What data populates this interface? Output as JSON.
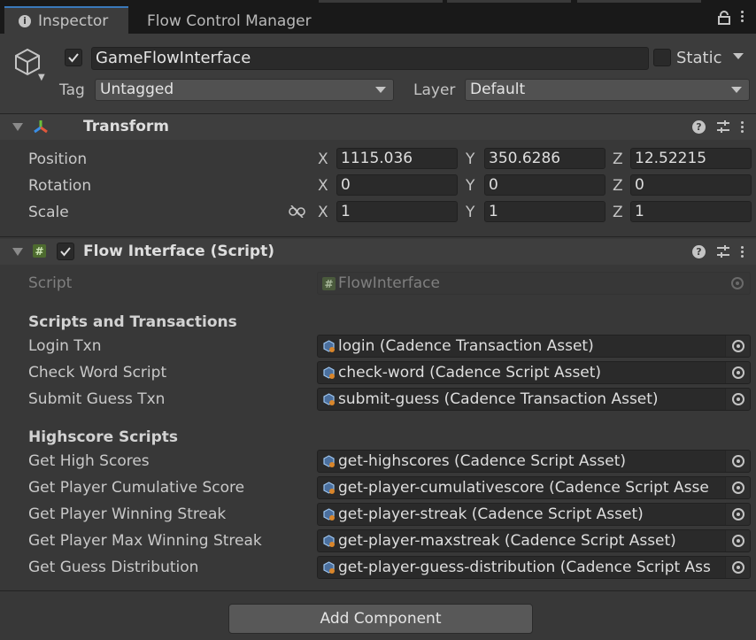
{
  "tabs": {
    "inspector": "Inspector",
    "flow_control": "Flow Control Manager"
  },
  "gameobject": {
    "name": "GameFlowInterface",
    "active": true,
    "static_label": "Static",
    "tag_label": "Tag",
    "tag_value": "Untagged",
    "layer_label": "Layer",
    "layer_value": "Default"
  },
  "transform": {
    "title": "Transform",
    "rows": [
      {
        "label": "Position",
        "x": "1115.036",
        "y": "350.6286",
        "z": "12.52215"
      },
      {
        "label": "Rotation",
        "x": "0",
        "y": "0",
        "z": "0"
      },
      {
        "label": "Scale",
        "x": "1",
        "y": "1",
        "z": "1"
      }
    ],
    "axis": {
      "x": "X",
      "y": "Y",
      "z": "Z"
    }
  },
  "flow_interface": {
    "title": "Flow Interface (Script)",
    "enabled": true,
    "script_label": "Script",
    "script_value": "FlowInterface",
    "section1": "Scripts and Transactions",
    "fields1": [
      {
        "label": "Login Txn",
        "value": "login (Cadence Transaction Asset)"
      },
      {
        "label": "Check Word Script",
        "value": "check-word (Cadence Script Asset)"
      },
      {
        "label": "Submit Guess Txn",
        "value": "submit-guess (Cadence Transaction Asset)"
      }
    ],
    "section2": "Highscore Scripts",
    "fields2": [
      {
        "label": "Get High Scores",
        "value": "get-highscores (Cadence Script Asset)"
      },
      {
        "label": "Get Player Cumulative Score",
        "value": "get-player-cumulativescore (Cadence Script Asse"
      },
      {
        "label": "Get Player Winning Streak",
        "value": "get-player-streak (Cadence Script Asset)"
      },
      {
        "label": "Get Player Max Winning Streak",
        "value": "get-player-maxstreak (Cadence Script Asset)"
      },
      {
        "label": "Get Guess Distribution",
        "value": "get-player-guess-distribution (Cadence Script Ass"
      }
    ]
  },
  "add_component": "Add Component"
}
